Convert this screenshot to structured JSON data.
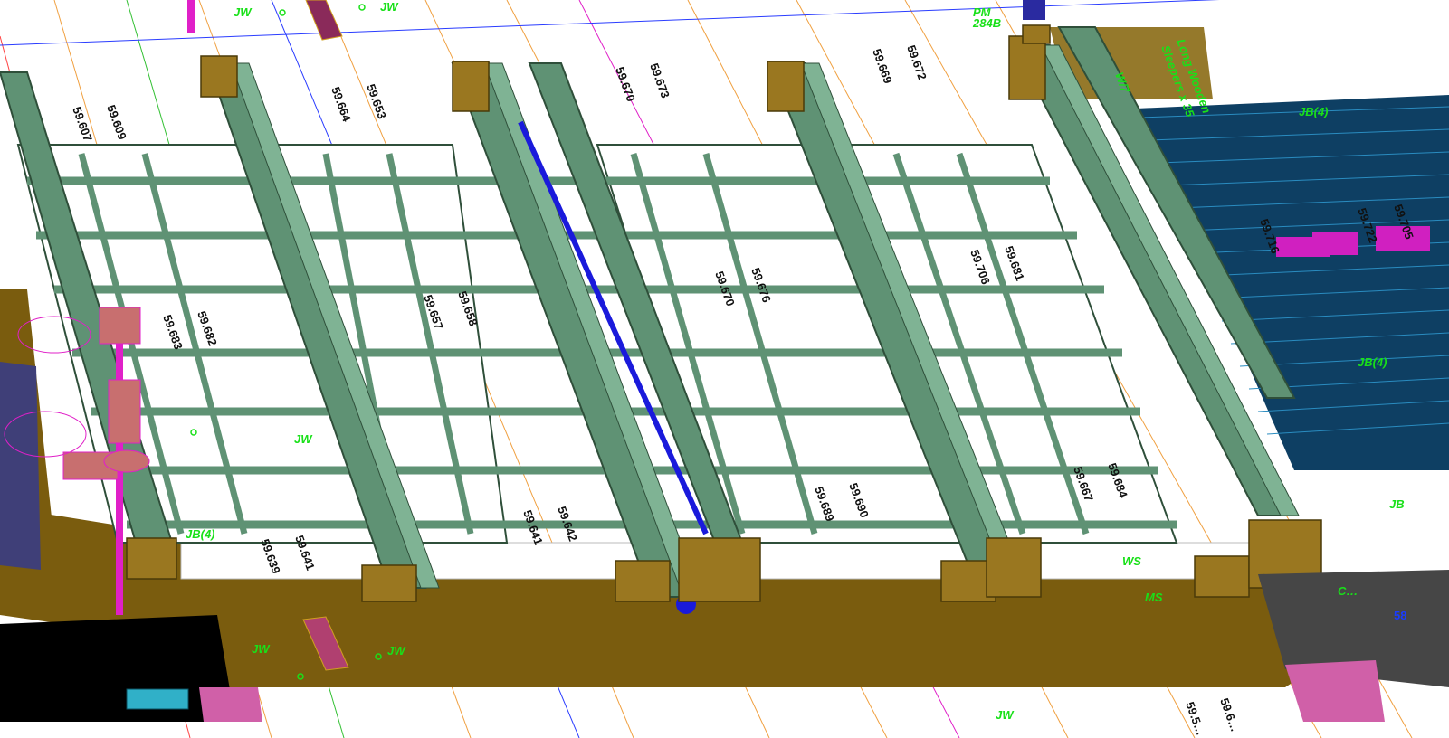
{
  "viewport": {
    "title": ""
  },
  "colors": {
    "background": "#ffffff",
    "ground": "#7a5c0e",
    "girder": "#5f9274",
    "girder_edge": "#2f4f3a",
    "deck_water": "#0e3f63",
    "deck_line": "#2a8cc0",
    "pipe": "#1a1adb",
    "magenta": "#e020c8",
    "pier": "#9a7720",
    "label_green": "#19e019",
    "dark_slab": "#444444"
  },
  "labels": {
    "jw_top_left": "JW",
    "jw_top_mid": "JW",
    "jw_bottom_left": "JW",
    "jw_bottom_mid": "JW",
    "jw_mid_left": "JW",
    "jw_bottom_right": "JW",
    "jb_left": "JB(4)",
    "jb_right_top": "JB(4)",
    "jb_right_mid": "JB(4)",
    "jb_right_bottom": "JB",
    "ws": "WS",
    "ms": "MS",
    "pm": "PM",
    "pm_num": "284B",
    "w7": "W/7",
    "long_sleepers": "Long Wooden",
    "long_sleepers_2": "Sleepers x 35",
    "cx": "C…",
    "right_num": "58",
    "lev_1": "59.607",
    "lev_2": "59.609",
    "lev_3": "59.664",
    "lev_4": "59.653",
    "lev_5": "59.670",
    "lev_6": "59.673",
    "lev_7": "59.669",
    "lev_8": "59.672",
    "lev_9": "59.683",
    "lev_10": "59.682",
    "lev_11": "59.657",
    "lev_12": "59.658",
    "lev_13": "59.670",
    "lev_14": "59.676",
    "lev_15": "59.706",
    "lev_16": "59.681",
    "lev_17": "59.639",
    "lev_18": "59.641",
    "lev_19": "59.641",
    "lev_20": "59.642",
    "lev_21": "59.689",
    "lev_22": "59.690",
    "lev_23": "59.667",
    "lev_24": "59.684",
    "lev_25": "59.5…",
    "lev_26": "59.6…",
    "lev_27": "59.716",
    "lev_28": "59.722",
    "lev_29": "59.705"
  }
}
